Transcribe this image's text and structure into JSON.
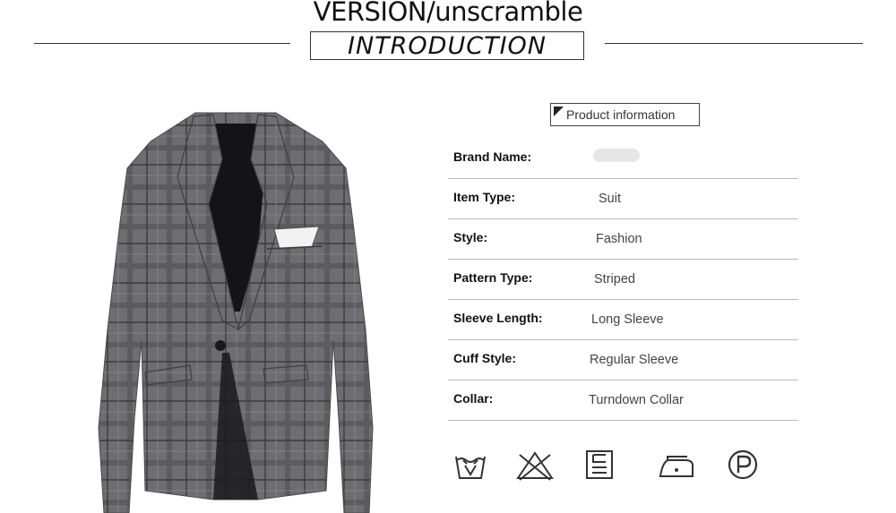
{
  "header": {
    "version_text": "VERSION/unscramble",
    "section_title": "INTRODUCTION"
  },
  "product_image": {
    "description_icon": "plaid-blazer-illustration",
    "accent_color": "#6b6b6e"
  },
  "info_label": "Product information",
  "specs": [
    {
      "label": "Brand Name:",
      "value": ""
    },
    {
      "label": "Item Type:",
      "value": "Suit"
    },
    {
      "label": "Style:",
      "value": "Fashion"
    },
    {
      "label": "Pattern Type:",
      "value": "Striped"
    },
    {
      "label": "Sleeve Length:",
      "value": "Long Sleeve"
    },
    {
      "label": "Cuff Style:",
      "value": "Regular Sleeve"
    },
    {
      "label": "Collar:",
      "value": "Turndown Collar"
    }
  ],
  "care_icons": [
    "wash-30-icon",
    "no-bleach-icon",
    "tumble-dry-icon",
    "iron-icon",
    "dry-clean-p-icon"
  ]
}
